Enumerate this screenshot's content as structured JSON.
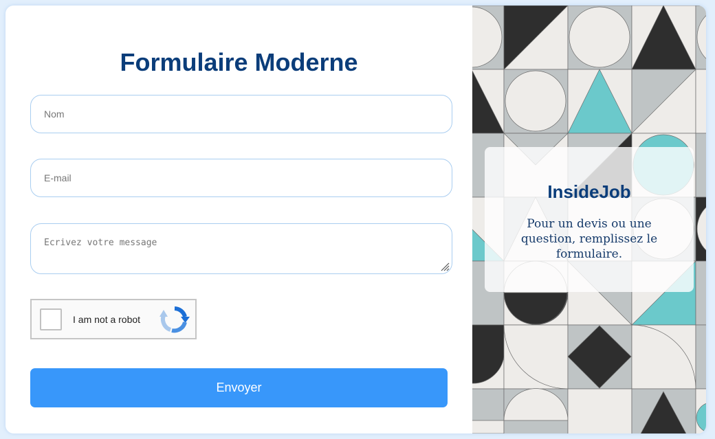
{
  "form": {
    "title": "Formulaire Moderne",
    "name_placeholder": "Nom",
    "email_placeholder": "E-mail",
    "message_placeholder": "Ecrivez votre message",
    "captcha_label": "I am not a robot",
    "submit_label": "Envoyer"
  },
  "aside": {
    "title": "InsideJob",
    "text": "Pour un devis ou une question, remplissez le formulaire."
  },
  "colors": {
    "page_background": "#e2effc",
    "title": "#0b3d7a",
    "input_border": "#a9cdf0",
    "button": "#3897fa",
    "pattern_dark": "#2e2e2e",
    "pattern_gray": "#bfc4c5",
    "pattern_light": "#eeece9",
    "pattern_teal": "#6bc9cb"
  },
  "icons": {
    "captcha": "recaptcha-arrows-icon",
    "resize": "resize-grip-icon"
  }
}
